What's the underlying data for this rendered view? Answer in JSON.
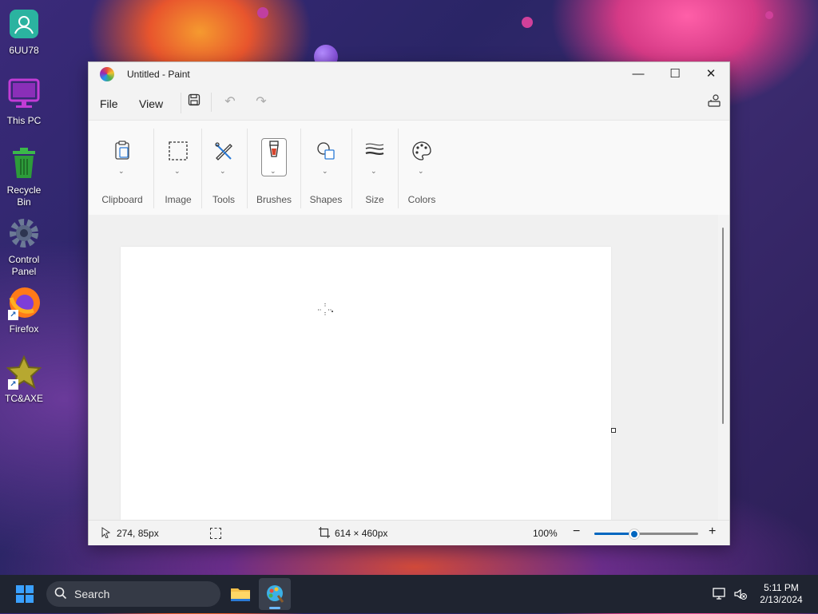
{
  "desktop": {
    "icons": [
      {
        "label": "6UU78",
        "icon": "user-folder-icon"
      },
      {
        "label": "This PC",
        "icon": "monitor-icon"
      },
      {
        "label": "Recycle Bin",
        "icon": "recycle-bin-icon"
      },
      {
        "label": "Control Panel",
        "icon": "gear-icon"
      },
      {
        "label": "Firefox",
        "icon": "firefox-icon"
      },
      {
        "label": "TC&AXE",
        "icon": "star-icon"
      }
    ]
  },
  "window": {
    "title": "Untitled - Paint",
    "controls": {
      "minimize": "—",
      "maximize": "☐",
      "close": "✕"
    },
    "menu": {
      "file": "File",
      "view": "View"
    },
    "ribbon": {
      "groups": [
        {
          "label": "Clipboard",
          "icon": "clipboard-icon"
        },
        {
          "label": "Image",
          "icon": "selection-icon"
        },
        {
          "label": "Tools",
          "icon": "tools-icon"
        },
        {
          "label": "Brushes",
          "icon": "brush-icon"
        },
        {
          "label": "Shapes",
          "icon": "shapes-icon"
        },
        {
          "label": "Size",
          "icon": "size-icon"
        },
        {
          "label": "Colors",
          "icon": "palette-icon"
        }
      ]
    },
    "status": {
      "cursor_position": "274, 85px",
      "canvas_size": "614 × 460px",
      "zoom": "100%",
      "zoom_fraction": 0.38
    }
  },
  "taskbar": {
    "search_placeholder": "Search",
    "time": "5:11 PM",
    "date": "2/13/2024"
  },
  "colors": {
    "accent": "#0067c0",
    "taskbar": "#1f2430"
  }
}
